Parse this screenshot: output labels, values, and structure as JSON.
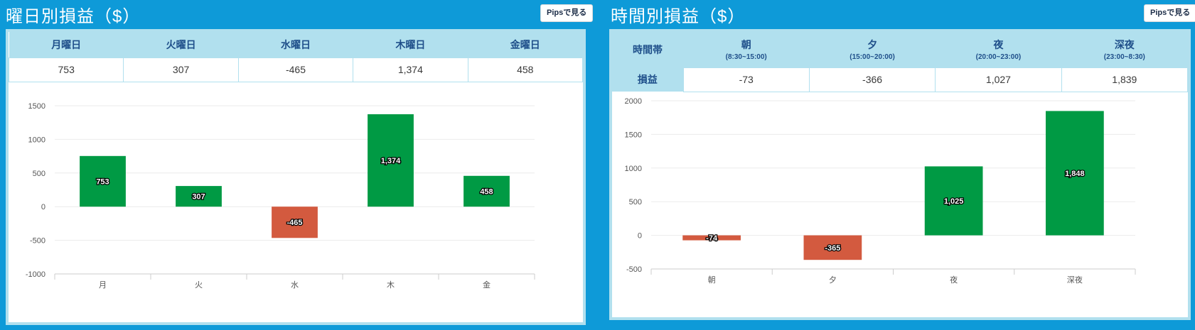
{
  "left": {
    "title": "曜日別損益（$）",
    "pips_button": "Pipsで見る",
    "headers": [
      "月曜日",
      "火曜日",
      "水曜日",
      "木曜日",
      "金曜日"
    ],
    "values": [
      "753",
      "307",
      "-465",
      "1,374",
      "458"
    ]
  },
  "right": {
    "title": "時間別損益（$）",
    "pips_button": "Pipsで見る",
    "row_header_1": "時間帯",
    "row_header_2": "損益",
    "headers": [
      {
        "name": "朝",
        "sub": "(8:30~15:00)"
      },
      {
        "name": "夕",
        "sub": "(15:00~20:00)"
      },
      {
        "name": "夜",
        "sub": "(20:00~23:00)"
      },
      {
        "name": "深夜",
        "sub": "(23:00~8:30)"
      }
    ],
    "values": [
      "-73",
      "-366",
      "1,027",
      "1,839"
    ]
  },
  "colors": {
    "positive": "#009a44",
    "negative": "#d35a3f",
    "header_bg": "#b1e0ee",
    "background": "#0e9ad8"
  },
  "chart_data": [
    {
      "type": "bar",
      "categories": [
        "月",
        "火",
        "水",
        "木",
        "金"
      ],
      "values": [
        753,
        307,
        -465,
        1374,
        458
      ],
      "labels": [
        "753",
        "307",
        "-465",
        "1,374",
        "458"
      ],
      "ylim": [
        -1000,
        1500
      ],
      "yticks": [
        -1000,
        -500,
        0,
        500,
        1000,
        1500
      ],
      "grid": true
    },
    {
      "type": "bar",
      "categories": [
        "朝",
        "夕",
        "夜",
        "深夜"
      ],
      "values": [
        -74,
        -365,
        1025,
        1848
      ],
      "labels": [
        "-74",
        "-365",
        "1,025",
        "1,848"
      ],
      "ylim": [
        -500,
        2000
      ],
      "yticks": [
        -500,
        0,
        500,
        1000,
        1500,
        2000
      ],
      "grid": true
    }
  ]
}
